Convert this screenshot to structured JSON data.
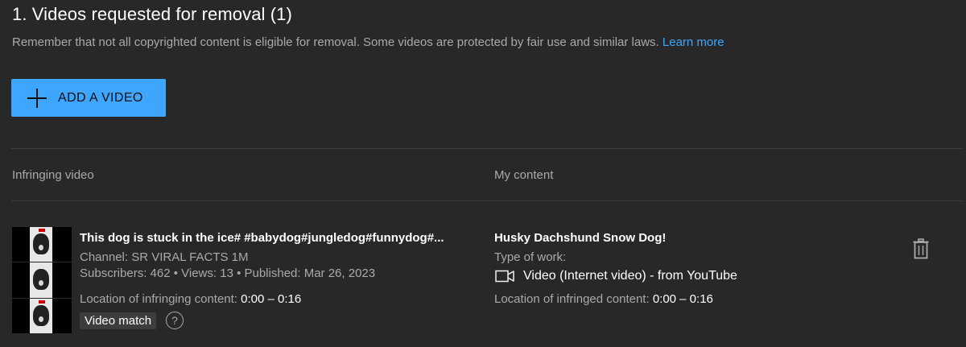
{
  "section": {
    "title": "1. Videos requested for removal (1)",
    "notice": "Remember that not all copyrighted content is eligible for removal. Some videos are protected by fair use and similar laws.",
    "learn_more": "Learn more"
  },
  "add_button": {
    "label": "ADD A VIDEO",
    "icon": "plus-icon"
  },
  "columns": {
    "infringing": "Infringing video",
    "my_content": "My content"
  },
  "infringing_video": {
    "title": "This dog is stuck in the ice# #babydog#jungledog#funnydog#...",
    "channel": "Channel: SR VIRAL FACTS 1M",
    "stats": "Subscribers: 462 • Views: 13 • Published: Mar 26, 2023",
    "location_label": "Location of infringing content:",
    "location_value": "0:00 – 0:16",
    "match_badge": "Video match",
    "help": "?"
  },
  "my_content": {
    "title": "Husky Dachshund Snow Dog!",
    "type_label": "Type of work:",
    "type_value": "Video (Internet video) - from YouTube",
    "type_icon": "video-camera-icon",
    "location_label": "Location of infringed content:",
    "location_value": "0:00 – 0:16"
  },
  "colors": {
    "background": "#282828",
    "accent": "#3ea6ff",
    "secondary_text": "#aaaaaa",
    "divider": "#3f3f3f"
  }
}
